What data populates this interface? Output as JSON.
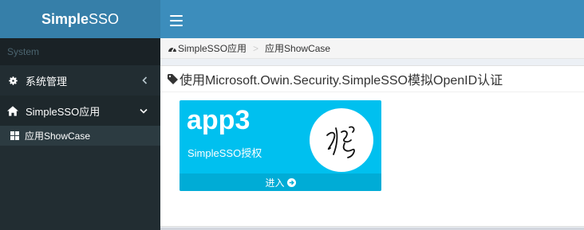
{
  "header": {
    "logo_bold": "Simple",
    "logo_light": "SSO"
  },
  "sidebar": {
    "section_header": "System",
    "items": [
      {
        "label": "系统管理",
        "icon": "gear-icon"
      },
      {
        "label": "SimpleSSO应用",
        "icon": "home-icon"
      }
    ],
    "subitem": {
      "label": "应用ShowCase",
      "icon": "grid-icon"
    }
  },
  "breadcrumb": {
    "root": "SimpleSSO应用",
    "current": "应用ShowCase"
  },
  "box": {
    "title": "使用Microsoft.Owin.Security.SimpleSSO模拟OpenID认证"
  },
  "tile": {
    "name": "app3",
    "description": "SimpleSSO授权",
    "action": "进入"
  },
  "colors": {
    "header": "#3c8dbc",
    "logo": "#367fa9",
    "sidebar": "#222d32",
    "tile": "#00c0ef",
    "tile_footer": "#00acd6"
  }
}
